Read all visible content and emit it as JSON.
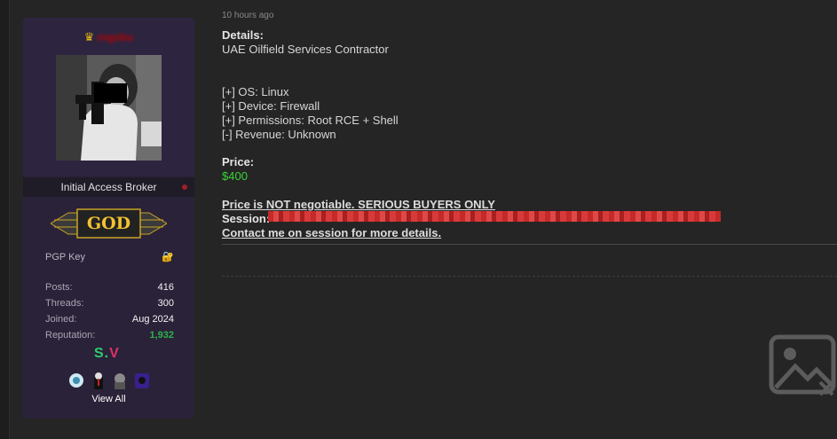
{
  "post": {
    "timestamp": "10 hours ago",
    "details_label": "Details:",
    "subject": "UAE Oilfield Services Contractor",
    "specs": [
      "[+] OS: Linux",
      "[+] Device: Firewall",
      "[+] Permissions: Root RCE + Shell",
      "[-] Revenue: Unknown"
    ],
    "price_label": "Price:",
    "price_value": "$400",
    "negotiable_note": "Price is NOT negotiable. SERIOUS BUYERS ONLY",
    "session_label": "Session:",
    "contact_note": "Contact me on session for more details."
  },
  "profile": {
    "username": "rngxbu",
    "user_title": "Initial Access Broker",
    "rank": "GOD",
    "pgp_label": "PGP Key",
    "stats": [
      {
        "label": "Posts:",
        "value": "416"
      },
      {
        "label": "Threads:",
        "value": "300"
      },
      {
        "label": "Joined:",
        "value": "Aug 2024"
      },
      {
        "label": "Reputation:",
        "value": "1,932"
      }
    ],
    "view_all_label": "View All"
  },
  "colors": {
    "username": "#b50000",
    "price": "#39d339",
    "reputation": "#2db34a",
    "crown": "#e4b613"
  },
  "icons": [
    "crown-icon",
    "lock-icon",
    "sv-logo",
    "award-icon",
    "image-placeholder-icon"
  ]
}
